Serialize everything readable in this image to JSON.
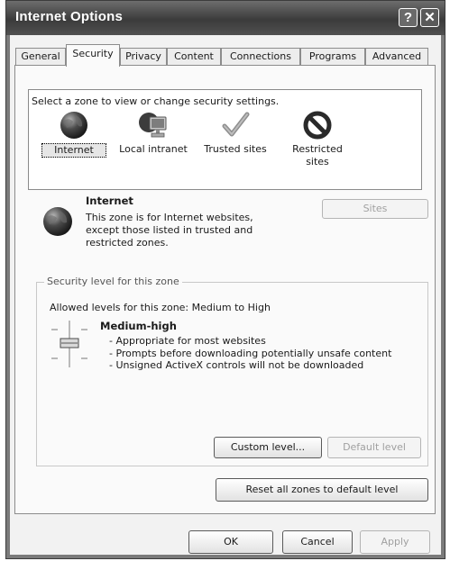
{
  "window": {
    "title": "Internet Options",
    "help": "?",
    "close": "✕"
  },
  "tabs": [
    {
      "label": "General"
    },
    {
      "label": "Security"
    },
    {
      "label": "Privacy"
    },
    {
      "label": "Content"
    },
    {
      "label": "Connections"
    },
    {
      "label": "Programs"
    },
    {
      "label": "Advanced"
    }
  ],
  "active_tab": "Security",
  "zones": {
    "prompt": "Select a zone to view or change security settings.",
    "items": [
      {
        "label": "Internet",
        "icon": "globe-icon",
        "selected": true
      },
      {
        "label": "Local intranet",
        "icon": "computer-network-icon",
        "selected": false
      },
      {
        "label": "Trusted sites",
        "icon": "checkmark-icon",
        "selected": false
      },
      {
        "label": "Restricted sites",
        "icon": "no-entry-icon",
        "selected": false
      }
    ]
  },
  "zone_info": {
    "title": "Internet",
    "description": "This zone is for Internet websites, except those listed in trusted and restricted zones.",
    "sites_button": "Sites"
  },
  "security_level": {
    "group_label": "Security level for this zone",
    "allowed": "Allowed levels for this zone: Medium to High",
    "level_name": "Medium-high",
    "lines": [
      "- Appropriate for most websites",
      "- Prompts before downloading potentially unsafe content",
      "- Unsigned ActiveX controls will not be downloaded"
    ],
    "custom_button": "Custom level...",
    "default_button": "Default level"
  },
  "reset_button": "Reset all zones to default level",
  "footer": {
    "ok": "OK",
    "cancel": "Cancel",
    "apply": "Apply"
  }
}
